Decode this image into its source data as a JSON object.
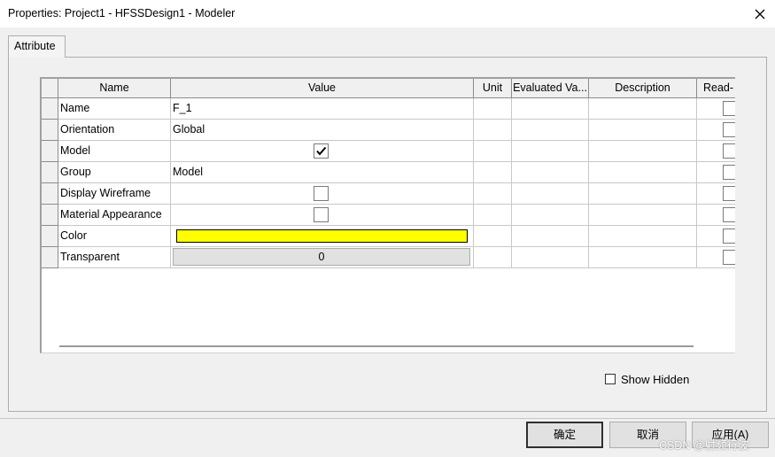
{
  "window": {
    "title": "Properties: Project1 - HFSSDesign1 - Modeler",
    "close_icon": "close-icon"
  },
  "tabs": [
    {
      "label": "Attribute",
      "active": true
    }
  ],
  "table": {
    "headers": [
      "Name",
      "Value",
      "Unit",
      "Evaluated Va...",
      "Description",
      "Read-"
    ],
    "rows": [
      {
        "name": "Name",
        "value": "F_1",
        "type": "text"
      },
      {
        "name": "Orientation",
        "value": "Global",
        "type": "text"
      },
      {
        "name": "Model",
        "value": "",
        "type": "checkbox",
        "checked": true
      },
      {
        "name": "Group",
        "value": "Model",
        "type": "text"
      },
      {
        "name": "Display Wireframe",
        "value": "",
        "type": "checkbox",
        "checked": false
      },
      {
        "name": "Material Appearance",
        "value": "",
        "type": "checkbox",
        "checked": false
      },
      {
        "name": "Color",
        "value": "",
        "type": "color",
        "color": "#ffff00"
      },
      {
        "name": "Transparent",
        "value": "0",
        "type": "button"
      }
    ]
  },
  "show_hidden": {
    "label": "Show Hidden",
    "checked": false
  },
  "buttons": {
    "ok": "确定",
    "cancel": "取消",
    "apply": "应用(A)"
  },
  "watermark": "CSDN @射频行波"
}
